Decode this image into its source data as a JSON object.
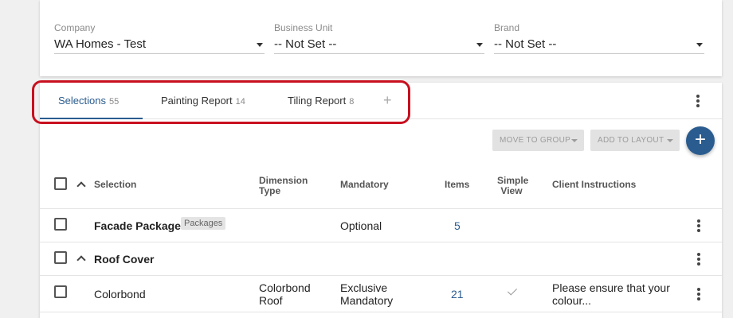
{
  "filters": {
    "company": {
      "label": "Company",
      "value": "WA Homes - Test"
    },
    "business_unit": {
      "label": "Business Unit",
      "value": "-- Not Set --"
    },
    "brand": {
      "label": "Brand",
      "value": "-- Not Set --"
    }
  },
  "tabs": [
    {
      "label": "Selections",
      "count": "55",
      "active": true
    },
    {
      "label": "Painting Report",
      "count": "14",
      "active": false
    },
    {
      "label": "Tiling Report",
      "count": "8",
      "active": false
    }
  ],
  "add_tab_symbol": "+",
  "toolbar": {
    "move_to_group": "MOVE TO GROUP",
    "add_to_layout": "ADD TO LAYOUT",
    "fab_symbol": "+"
  },
  "table": {
    "columns": {
      "selection": "Selection",
      "dimension_type": [
        "Dimension",
        "Type"
      ],
      "mandatory": "Mandatory",
      "items": "Items",
      "simple_view": [
        "Simple",
        "View"
      ],
      "client_instructions": "Client Instructions"
    },
    "rows": [
      {
        "selection": "Facade Packages",
        "badge": "Packages",
        "dimension_type": "",
        "mandatory": "Optional",
        "items": "5",
        "simple_view": false,
        "client_instructions": ""
      },
      {
        "selection": "Roof Cover",
        "group": true
      },
      {
        "selection": "Colorbond",
        "dimension_type": [
          "Colorbond",
          "Roof"
        ],
        "mandatory": [
          "Exclusive",
          "Mandatory"
        ],
        "items": "21",
        "simple_view": true,
        "client_instructions": [
          "Please ensure that your",
          "colour..."
        ]
      }
    ]
  },
  "colors": {
    "accent": "#2a5c8f",
    "highlight": "#c8101f"
  }
}
